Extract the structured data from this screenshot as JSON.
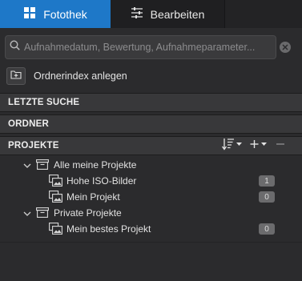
{
  "tabs": [
    {
      "label": "Fotothek",
      "icon": "grid-icon",
      "active": true
    },
    {
      "label": "Bearbeiten",
      "icon": "sliders-icon",
      "active": false
    }
  ],
  "search": {
    "placeholder": "Aufnahmedatum, Bewertung, Aufnahmeparameter...",
    "value": ""
  },
  "folder_index": {
    "label": "Ordnerindex anlegen"
  },
  "sections": {
    "recent": "LETZTE SUCHE",
    "folders": "ORDNER",
    "projects": "PROJEKTE"
  },
  "projects_tree": {
    "group1": {
      "label": "Alle meine Projekte"
    },
    "item1": {
      "label": "Hohe ISO-Bilder",
      "count": "1"
    },
    "item2": {
      "label": "Mein Projekt",
      "count": "0"
    },
    "group2": {
      "label": "Private Projekte"
    },
    "item3": {
      "label": "Mein bestes Projekt",
      "count": "0"
    }
  },
  "colors": {
    "accent": "#1e78c8",
    "background": "#2b2b2d",
    "section": "#38383a",
    "badge": "#6b6b6d"
  }
}
